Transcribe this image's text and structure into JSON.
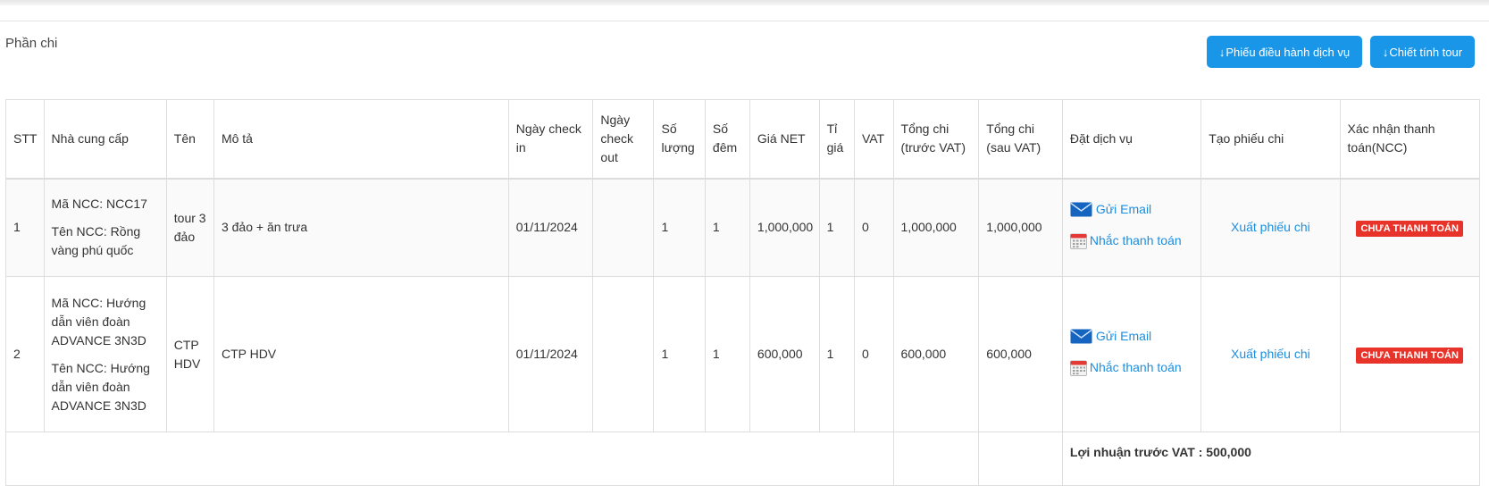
{
  "section": {
    "title": "Phần chi"
  },
  "buttons": {
    "phieu_dieu_hanh": "Phiếu điều hành dịch vụ",
    "chiet_tinh": "Chiết tính tour",
    "arrow": "↓"
  },
  "table": {
    "headers": {
      "stt": "STT",
      "ncc": "Nhà cung cấp",
      "ten": "Tên",
      "mota": "Mô tả",
      "checkin": "Ngày check in",
      "checkout": "Ngày check out",
      "soluong": "Số lượng",
      "sodem": "Số đêm",
      "gianet": "Giá NET",
      "tigia": "Tỉ giá",
      "vat": "VAT",
      "tongtruoc": "Tổng chi (trước VAT)",
      "tongsau": "Tổng chi (sau VAT)",
      "datdv": "Đặt dịch vụ",
      "taophieu": "Tạo phiếu chi",
      "xacnhan": "Xác nhận thanh toán(NCC)"
    },
    "rows": [
      {
        "stt": "1",
        "ma_ncc": "Mã NCC: NCC17",
        "ten_ncc": "Tên NCC: Rồng vàng phú quốc",
        "ten": "tour 3 đảo",
        "mota": "3 đảo + ăn trưa",
        "checkin": "01/11/2024",
        "checkout": "",
        "soluong": "1",
        "sodem": "1",
        "gianet": "1,000,000",
        "tigia": "1",
        "vat": "0",
        "tongtruoc": "1,000,000",
        "tongsau": "1,000,000",
        "gui_email": "Gửi Email",
        "nhac_tt": "Nhắc thanh toán",
        "xuat_phieu": "Xuất phiếu chi",
        "status": "CHƯA THANH TOÁN"
      },
      {
        "stt": "2",
        "ma_ncc": "Mã NCC: Hướng dẫn viên đoàn ADVANCE 3N3D",
        "ten_ncc": "Tên NCC: Hướng dẫn viên đoàn ADVANCE 3N3D",
        "ten": "CTP HDV",
        "mota": "CTP HDV",
        "checkin": "01/11/2024",
        "checkout": "",
        "soluong": "1",
        "sodem": "1",
        "gianet": "600,000",
        "tigia": "1",
        "vat": "0",
        "tongtruoc": "600,000",
        "tongsau": "600,000",
        "gui_email": "Gửi Email",
        "nhac_tt": "Nhắc thanh toán",
        "xuat_phieu": "Xuất phiếu chi",
        "status": "CHƯA THANH TOÁN"
      }
    ],
    "footer": {
      "profit_label": "Lợi nhuận trước VAT : 500,000"
    }
  },
  "icons": {
    "mail": "mail-icon",
    "calendar": "calendar-icon",
    "arrow": "arrow-down-icon"
  },
  "colors": {
    "accent": "#1a96e8",
    "link": "#1a8ee0",
    "badge": "#e8332a"
  }
}
